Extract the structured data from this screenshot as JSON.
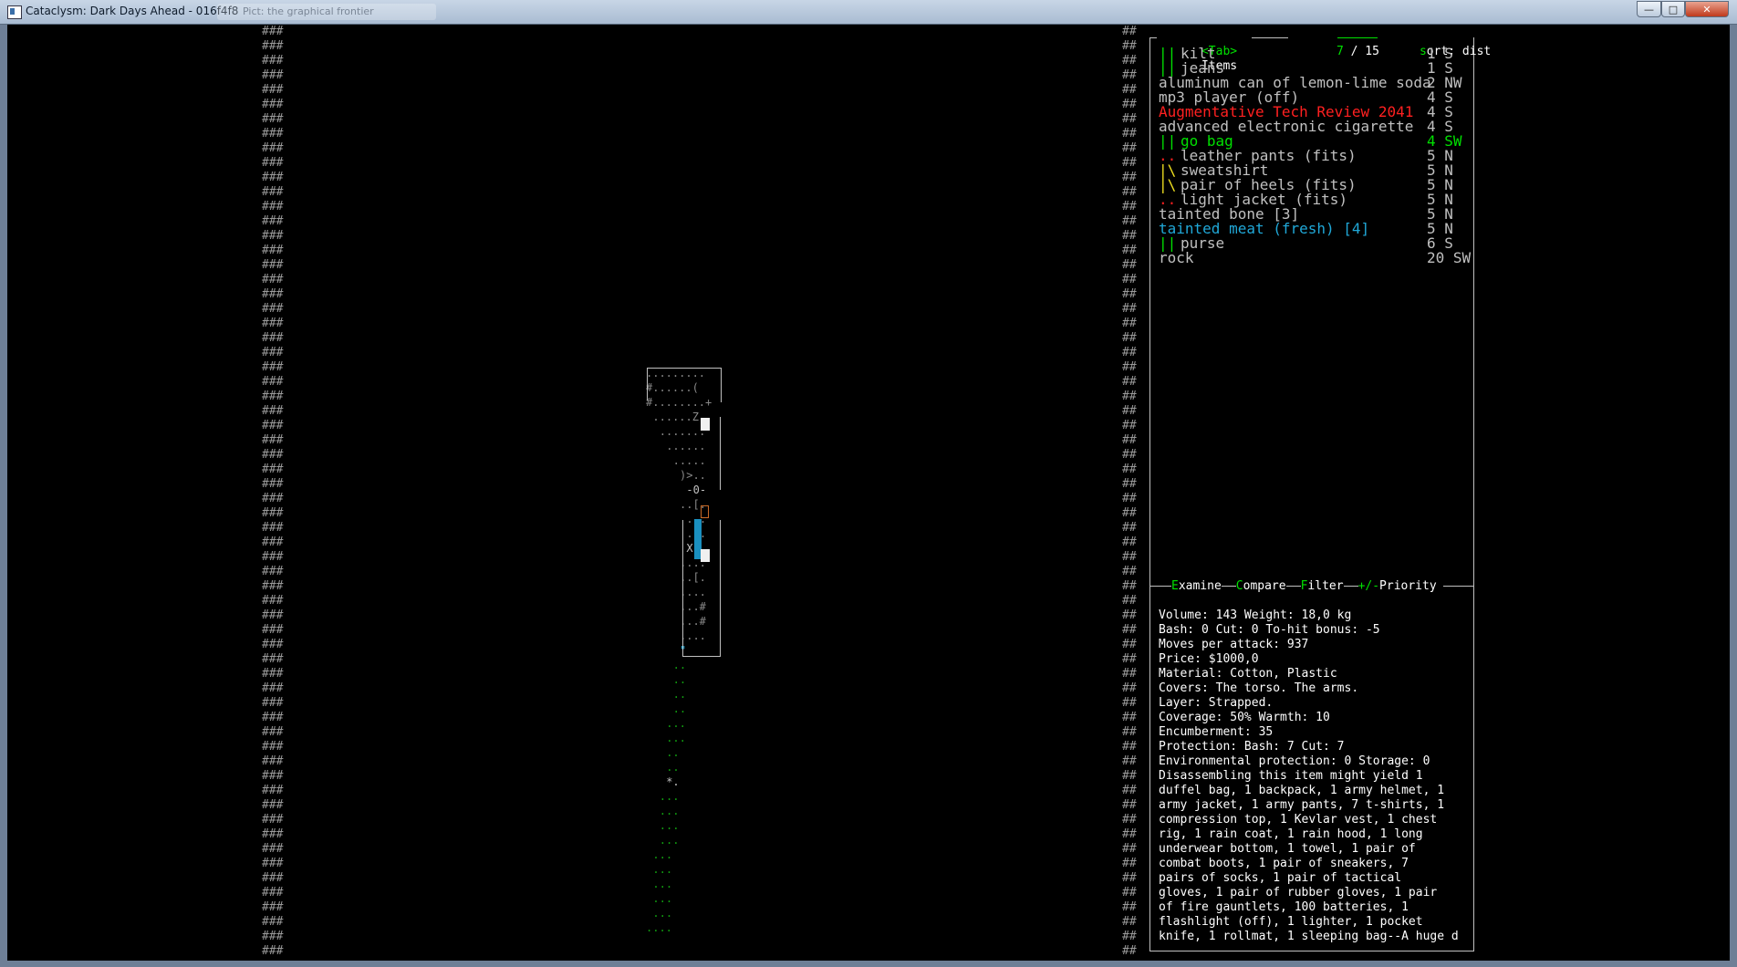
{
  "window": {
    "title": "Cataclysm: Dark Days Ahead - 016f4f8",
    "ghost_tab": "Pict: the graphical frontier",
    "min_glyph": "—",
    "max_glyph": "□",
    "close_glyph": "✕"
  },
  "colors": {
    "background": "#000000",
    "text": "#c0c0c0",
    "green": "#00e000",
    "red": "#ff2020",
    "cyan": "#20a8d8",
    "yellow": "#f0e020",
    "orange": "#c86a28",
    "blue": "#3050ff",
    "map_floor": "#888888",
    "map_grass": "#10a010"
  },
  "walls": {
    "left_glyph": "###",
    "right_glyph": "##"
  },
  "items_panel": {
    "tab_key": "<Tab>",
    "title": "Items",
    "page_current": "7",
    "page_sep": " / ",
    "page_total": "15",
    "sort_key": "s",
    "sort_label": "ort: dist",
    "items": [
      {
        "icon": "||",
        "name": "kilt",
        "dist": "1 S",
        "color": "text",
        "icon_color": "green"
      },
      {
        "icon": "||",
        "name": "jeans",
        "dist": "1 S",
        "color": "text",
        "icon_color": "green"
      },
      {
        "icon": "",
        "name": "aluminum can of lemon-lime soda",
        "dist": "2 NW",
        "color": "text",
        "icon_color": "text"
      },
      {
        "icon": "",
        "name": "mp3 player (off)",
        "dist": "4 S",
        "color": "text",
        "icon_color": "text"
      },
      {
        "icon": "",
        "name": "Augmentative Tech Review 2041",
        "dist": "4 S",
        "color": "red",
        "icon_color": "red"
      },
      {
        "icon": "",
        "name": "advanced electronic cigarette",
        "dist": "4 S",
        "color": "text",
        "icon_color": "text"
      },
      {
        "icon": "||",
        "name": "go bag",
        "dist": "4 SW",
        "color": "green",
        "icon_color": "green",
        "selected": true
      },
      {
        "icon": "..",
        "name": "leather pants (fits)",
        "dist": "5 N",
        "color": "text",
        "icon_color": "red"
      },
      {
        "icon": "|\\",
        "name": "sweatshirt",
        "dist": "5 N",
        "color": "text",
        "icon_color": "yellow"
      },
      {
        "icon": "|\\",
        "name": "pair of heels (fits)",
        "dist": "5 N",
        "color": "text",
        "icon_color": "yellow"
      },
      {
        "icon": "..",
        "name": "light jacket (fits)",
        "dist": "5 N",
        "color": "text",
        "icon_color": "red"
      },
      {
        "icon": "",
        "name": "tainted bone [3]",
        "dist": "5 N",
        "color": "text",
        "icon_color": "text"
      },
      {
        "icon": "",
        "name": "tainted meat (fresh) [4]",
        "dist": "5 N",
        "color": "cyan",
        "icon_color": "cyan"
      },
      {
        "icon": "||",
        "name": "purse",
        "dist": "6 S",
        "color": "text",
        "icon_color": "green"
      },
      {
        "icon": "",
        "name": "rock",
        "dist": "20 SW",
        "color": "text",
        "icon_color": "text"
      }
    ]
  },
  "actions": [
    {
      "key": "E",
      "label": "xamine"
    },
    {
      "key": "C",
      "label": "ompare"
    },
    {
      "key": "F",
      "label": "ilter"
    },
    {
      "key": "+/-",
      "label": "Priority"
    }
  ],
  "info_lines": [
    "Volume: 143 Weight: 18,0 kg",
    "Bash: 0 Cut: 0 To-hit bonus: -5",
    "Moves per attack: 937",
    "Price: $1000,0",
    "Material: Cotton, Plastic",
    "Covers: The torso. The arms.",
    "Layer: Strapped.",
    "Coverage: 50% Warmth: 10",
    "Encumberment: 35",
    "Protection: Bash: 7 Cut: 7",
    "Environmental protection: 0 Storage: 0",
    "Disassembling this item might yield 1",
    "duffel bag, 1 backpack, 1 army helmet, 1",
    "army jacket, 1 army pants, 7 t-shirts, 1",
    "compression top, 1 Kevlar vest, 1 chest",
    "rig, 1 rain coat, 1 rain hood, 1 long",
    "underwear bottom, 1 towel, 1 pair of",
    "combat boots, 1 pair of sneakers, 7",
    "pairs of socks, 1 pair of tactical",
    "gloves, 1 pair of rubber gloves, 1 pair",
    "of fire gauntlets, 100 batteries, 1",
    "flashlight (off), 1 lighter, 1 pocket",
    "knife, 1 rollmat, 1 sleeping bag--A huge d"
  ],
  "map": {
    "rows": [
      {
        "text": ".........",
        "color": "map_floor",
        "col": 0
      },
      {
        "text": "#......(",
        "color": "map_floor",
        "col": 0
      },
      {
        "text": "#........+",
        "color": "map_floor",
        "col": 0
      },
      {
        "text": "......Z.",
        "color": "map_floor",
        "col": 1
      },
      {
        "text": ".......",
        "color": "map_floor",
        "col": 2
      },
      {
        "text": "......",
        "color": "map_floor",
        "col": 3
      },
      {
        "text": ".....",
        "color": "map_floor",
        "col": 4
      },
      {
        "text": ")>..",
        "color": "map_floor",
        "col": 5
      },
      {
        "text": "-0-",
        "color": "text",
        "col": 6
      },
      {
        "text": "..[.",
        "color": "map_floor",
        "col": 5
      },
      {
        "text": "...",
        "color": "map_floor",
        "col": 6
      },
      {
        "text": "...",
        "color": "map_floor",
        "col": 6
      },
      {
        "text": "X[",
        "color": "text",
        "col": 6
      },
      {
        "text": "....",
        "color": "map_floor",
        "col": 5
      },
      {
        "text": "..[.",
        "color": "map_floor",
        "col": 5
      },
      {
        "text": "....",
        "color": "map_floor",
        "col": 5
      },
      {
        "text": "...#",
        "color": "map_floor",
        "col": 5
      },
      {
        "text": "...#",
        "color": "map_floor",
        "col": 5
      },
      {
        "text": "....",
        "color": "map_floor",
        "col": 5
      },
      {
        "text": "\"",
        "color": "cyan",
        "col": 5
      },
      {
        "text": "..",
        "color": "map_grass",
        "col": 4
      },
      {
        "text": "..",
        "color": "map_grass",
        "col": 4
      },
      {
        "text": "..",
        "color": "map_grass",
        "col": 4
      },
      {
        "text": "..",
        "color": "map_grass",
        "col": 4
      },
      {
        "text": "...",
        "color": "map_grass",
        "col": 3
      },
      {
        "text": "...",
        "color": "map_grass",
        "col": 3
      },
      {
        "text": "..",
        "color": "map_grass",
        "col": 3
      },
      {
        "text": "..",
        "color": "map_grass",
        "col": 3
      },
      {
        "text": "*.",
        "color": "text",
        "col": 3
      },
      {
        "text": "...",
        "color": "map_grass",
        "col": 2
      },
      {
        "text": "...",
        "color": "map_grass",
        "col": 2
      },
      {
        "text": "...",
        "color": "map_grass",
        "col": 2
      },
      {
        "text": "...",
        "color": "map_grass",
        "col": 2
      },
      {
        "text": "...",
        "color": "map_grass",
        "col": 1
      },
      {
        "text": "...",
        "color": "map_grass",
        "col": 1
      },
      {
        "text": "...",
        "color": "map_grass",
        "col": 1
      },
      {
        "text": "...",
        "color": "map_grass",
        "col": 1
      },
      {
        "text": "...",
        "color": "map_grass",
        "col": 1
      },
      {
        "text": "....",
        "color": "map_grass",
        "col": 0
      }
    ]
  }
}
